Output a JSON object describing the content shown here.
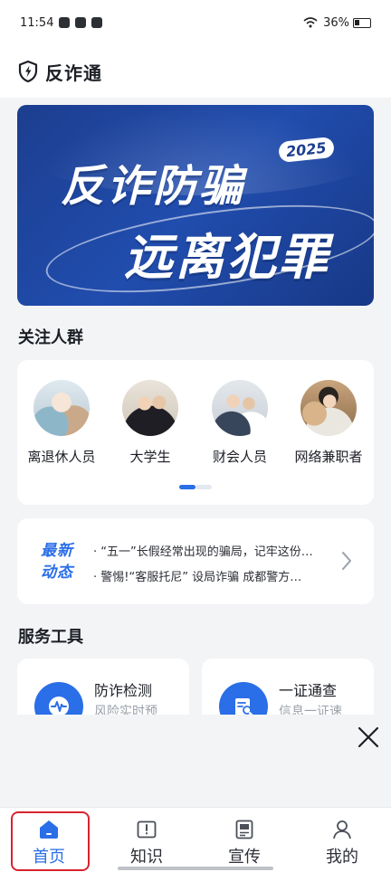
{
  "status_bar": {
    "time": "11:54",
    "battery": "36%",
    "battery_level": 0.36
  },
  "header": {
    "title": "反诈通",
    "icon": "shield-icon"
  },
  "banner": {
    "line1": "反诈防骗",
    "line2": "远离犯罪",
    "year": "2025"
  },
  "groups": {
    "title": "关注人群",
    "items": [
      {
        "label": "离退休人员",
        "icon": "retirees-photo"
      },
      {
        "label": "大学生",
        "icon": "graduates-photo"
      },
      {
        "label": "财会人员",
        "icon": "accountants-photo"
      },
      {
        "label": "网络兼职者",
        "icon": "online-parttime-photo"
      }
    ]
  },
  "news": {
    "badge_line1": "最新",
    "badge_line2": "动态",
    "items": [
      "· “五一”长假经常出现的骗局，记牢这份…",
      "· 警惕!“客服托尼” 设局诈骗 成都警方…"
    ]
  },
  "services": {
    "title": "服务工具",
    "tools": [
      {
        "name": "防诈检测",
        "subtitle": "风险实时预",
        "icon": "heartbeat-icon"
      },
      {
        "name": "一证通查",
        "subtitle": "信息一证速",
        "icon": "id-card-icon"
      }
    ]
  },
  "tabs": [
    {
      "label": "首页",
      "icon": "home-icon",
      "active": true
    },
    {
      "label": "知识",
      "icon": "book-icon",
      "active": false
    },
    {
      "label": "宣传",
      "icon": "poster-icon",
      "active": false
    },
    {
      "label": "我的",
      "icon": "user-icon",
      "active": false
    }
  ],
  "colors": {
    "accent": "#2a6ee8",
    "banner": "#214dae",
    "highlight": "#d8232f"
  }
}
